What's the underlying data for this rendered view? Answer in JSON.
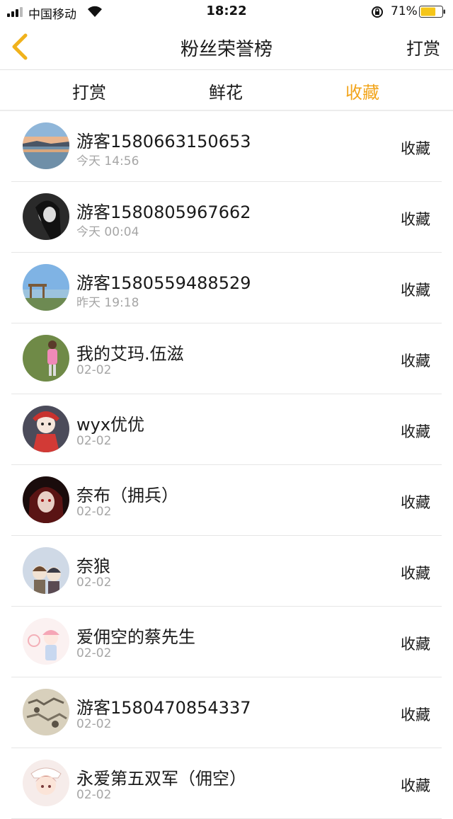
{
  "status": {
    "carrier": "中国移动",
    "time": "18:22",
    "battery": "71%",
    "battery_level": 0.71,
    "battery_color": "#f5c518"
  },
  "nav": {
    "title": "粉丝荣誉榜",
    "right": "打赏",
    "back_icon": "chevron-left-icon",
    "back_color": "#f0b21c"
  },
  "tabs": [
    {
      "label": "打赏",
      "active": false
    },
    {
      "label": "鲜花",
      "active": false
    },
    {
      "label": "收藏",
      "active": true
    }
  ],
  "accent": "#f2a51c",
  "list": [
    {
      "name": "游客1580663150653",
      "time": "今天 14:56",
      "action": "收藏",
      "avatar": "lake-sunset-avatar"
    },
    {
      "name": "游客1580805967662",
      "time": "今天 00:04",
      "action": "收藏",
      "avatar": "bw-girl-avatar"
    },
    {
      "name": "游客1580559488529",
      "time": "昨天 19:18",
      "action": "收藏",
      "avatar": "pier-sky-avatar"
    },
    {
      "name": "我的艾玛.伍滋",
      "time": "02-02",
      "action": "收藏",
      "avatar": "pink-figure-grass-avatar"
    },
    {
      "name": "wyx优优",
      "time": "02-02",
      "action": "收藏",
      "avatar": "opera-doll-avatar"
    },
    {
      "name": "奈布（拥兵）",
      "time": "02-02",
      "action": "收藏",
      "avatar": "dark-anime-avatar"
    },
    {
      "name": "奈狼",
      "time": "02-02",
      "action": "收藏",
      "avatar": "chibi-pair-avatar"
    },
    {
      "name": "爱佣空的蔡先生",
      "time": "02-02",
      "action": "收藏",
      "avatar": "pink-chibi-avatar"
    },
    {
      "name": "游客1580470854337",
      "time": "02-02",
      "action": "收藏",
      "avatar": "sketch-avatar"
    },
    {
      "name": "永爱第五双军（佣空）",
      "time": "02-02",
      "action": "收藏",
      "avatar": "maid-chibi-avatar"
    }
  ]
}
